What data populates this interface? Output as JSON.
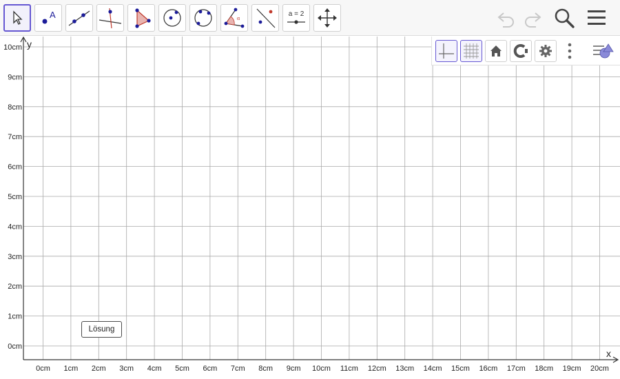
{
  "toolbar": {
    "tools": [
      {
        "name": "move-tool",
        "active": true
      },
      {
        "name": "point-tool",
        "label": "A"
      },
      {
        "name": "line-tool"
      },
      {
        "name": "perpendicular-line-tool"
      },
      {
        "name": "polygon-tool"
      },
      {
        "name": "circle-center-point-tool"
      },
      {
        "name": "circle-three-points-tool"
      },
      {
        "name": "angle-tool",
        "label": "α"
      },
      {
        "name": "reflect-about-line-tool"
      },
      {
        "name": "slider-tool",
        "label": "a = 2"
      },
      {
        "name": "move-graphics-view-tool"
      }
    ],
    "right_icons": [
      "undo-icon",
      "redo-icon",
      "search-icon",
      "menu-icon"
    ]
  },
  "style_bar": {
    "buttons": [
      "axes-toggle",
      "grid-toggle",
      "standard-view-home",
      "graphics-view-settings-c",
      "settings-gear",
      "more-vertical"
    ],
    "toggle_icon": "style-bar-toggle"
  },
  "axes": {
    "x_label": "x",
    "y_label": "y",
    "x_ticks": [
      "0cm",
      "1cm",
      "2cm",
      "3cm",
      "4cm",
      "5cm",
      "6cm",
      "7cm",
      "8cm",
      "9cm",
      "10cm",
      "11cm",
      "12cm",
      "13cm",
      "14cm",
      "15cm",
      "16cm",
      "17cm",
      "18cm",
      "19cm",
      "20cm"
    ],
    "y_ticks": [
      "0cm",
      "1cm",
      "2cm",
      "3cm",
      "4cm",
      "5cm",
      "6cm",
      "7cm",
      "8cm",
      "9cm",
      "10cm"
    ]
  },
  "buttons": {
    "solution_label": "Lösung"
  },
  "colors": {
    "accent": "#6557d2",
    "grid": "#a9a9a9",
    "axis": "#333333"
  }
}
